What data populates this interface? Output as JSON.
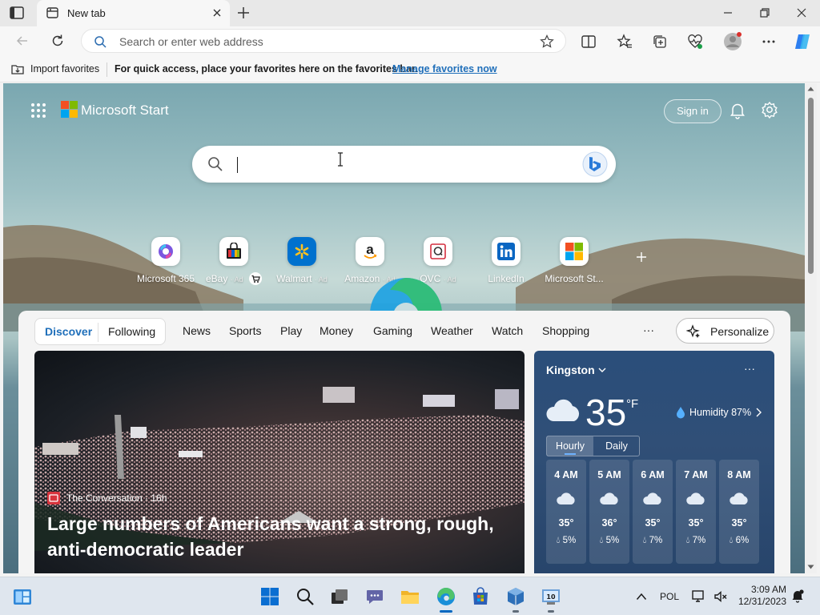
{
  "browser": {
    "tab_title": "New tab",
    "address_placeholder": "Search or enter web address"
  },
  "favorites_bar": {
    "import_label": "Import favorites",
    "message": "For quick access, place your favorites here on the favorites bar.",
    "manage_link": "Manage favorites now"
  },
  "start": {
    "title": "Microsoft Start",
    "sign_in": "Sign in"
  },
  "quick_links": [
    {
      "label": "Microsoft 365",
      "ad": "",
      "icon": "microsoft-365-icon"
    },
    {
      "label": "eBay",
      "ad": "· Ad",
      "icon": "ebay-icon"
    },
    {
      "label": "Walmart",
      "ad": "· Ad",
      "icon": "walmart-icon"
    },
    {
      "label": "Amazon",
      "ad": "· Ad",
      "icon": "amazon-icon"
    },
    {
      "label": "QVC",
      "ad": "· Ad",
      "icon": "qvc-icon"
    },
    {
      "label": "LinkedIn",
      "ad": "",
      "icon": "linkedin-icon"
    },
    {
      "label": "Microsoft St...",
      "ad": "",
      "icon": "microsoft-store-icon"
    }
  ],
  "feed": {
    "pill_discover": "Discover",
    "pill_following": "Following",
    "categories": [
      "News",
      "Sports",
      "Play",
      "Money",
      "Gaming",
      "Weather",
      "Watch",
      "Shopping"
    ],
    "more": "···",
    "personalize": "Personalize",
    "hero": {
      "source": "The Conversation · 16h",
      "headline": "Large numbers of Americans want a strong, rough, anti-democratic leader"
    }
  },
  "weather": {
    "city": "Kingston",
    "temp": "35",
    "unit": "°F",
    "humidity": "Humidity 87%",
    "tab_hourly": "Hourly",
    "tab_daily": "Daily",
    "more": "···",
    "hours": [
      {
        "time": "4 AM",
        "temp": "35°",
        "precip": "5%"
      },
      {
        "time": "5 AM",
        "temp": "36°",
        "precip": "5%"
      },
      {
        "time": "6 AM",
        "temp": "35°",
        "precip": "7%"
      },
      {
        "time": "7 AM",
        "temp": "35°",
        "precip": "7%"
      },
      {
        "time": "8 AM",
        "temp": "35°",
        "precip": "6%"
      }
    ]
  },
  "taskbar": {
    "language": "POL",
    "time": "3:09 AM",
    "date": "12/31/2023"
  },
  "colors": {
    "accent": "#0067c0",
    "link": "#1f6fba",
    "weather_bg": "#2a4e7a"
  }
}
